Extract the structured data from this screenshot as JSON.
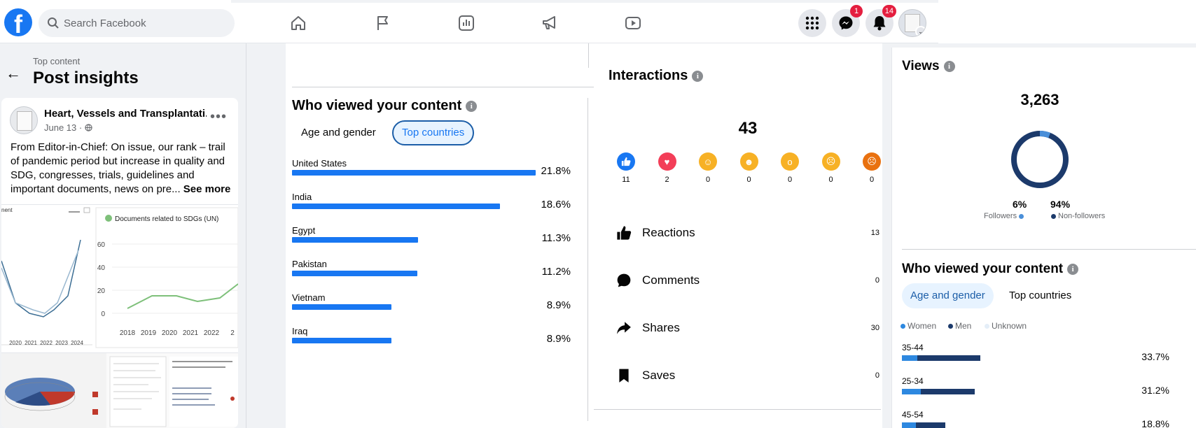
{
  "topbar": {
    "logo": "f",
    "search_placeholder": "Search Facebook",
    "nav_icons": [
      "home-icon",
      "flag-icon",
      "insights-icon",
      "megaphone-icon",
      "video-icon"
    ],
    "messenger_badge": "1",
    "notifications_badge": "14"
  },
  "left": {
    "breadcrumb": "Top content",
    "title": "Post insights",
    "post": {
      "author": "Heart, Vessels and Transplantati...",
      "date": "June 13 ·",
      "text": "From Editor-in-Chief: On issue, our rank – trail of pandemic period but increase in quality and SDG, congresses, trials, guidelines and important documents, news on pre...",
      "see_more": "See more",
      "image_legend": "Documents related to SDGs (UN)",
      "image_corner": "nent",
      "image_years": [
        "2018",
        "2019",
        "2020",
        "2021",
        "2022",
        "2"
      ],
      "image_y_ticks": [
        "60",
        "40",
        "20",
        "0"
      ],
      "image_left_years": [
        "2020",
        "2021",
        "2022",
        "2023",
        "2024"
      ]
    }
  },
  "who_viewed_countries": {
    "title": "Who viewed your content",
    "tabs": [
      "Age and gender",
      "Top countries"
    ],
    "active_tab": "Top countries",
    "countries": [
      {
        "name": "United States",
        "pct": "21.8%",
        "value": 21.8
      },
      {
        "name": "India",
        "pct": "18.6%",
        "value": 18.6
      },
      {
        "name": "Egypt",
        "pct": "11.3%",
        "value": 11.3
      },
      {
        "name": "Pakistan",
        "pct": "11.2%",
        "value": 11.2
      },
      {
        "name": "Vietnam",
        "pct": "8.9%",
        "value": 8.9
      },
      {
        "name": "Iraq",
        "pct": "8.9%",
        "value": 8.9
      }
    ]
  },
  "interactions": {
    "title": "Interactions",
    "total": "43",
    "reactions": [
      {
        "icon": "like-icon",
        "count": "11",
        "color": "#1877f2"
      },
      {
        "icon": "love-icon",
        "count": "2",
        "color": "#f33e58"
      },
      {
        "icon": "care-icon",
        "count": "0",
        "color": "#f7b125"
      },
      {
        "icon": "haha-icon",
        "count": "0",
        "color": "#f7b125"
      },
      {
        "icon": "wow-icon",
        "count": "0",
        "color": "#f7b125"
      },
      {
        "icon": "sad-icon",
        "count": "0",
        "color": "#f7b125"
      },
      {
        "icon": "angry-icon",
        "count": "0",
        "color": "#e9710f"
      }
    ],
    "metrics": [
      {
        "label": "Reactions",
        "value": "13",
        "icon": "thumbs-up-icon"
      },
      {
        "label": "Comments",
        "value": "0",
        "icon": "comment-icon"
      },
      {
        "label": "Shares",
        "value": "30",
        "icon": "share-icon"
      },
      {
        "label": "Saves",
        "value": "0",
        "icon": "bookmark-icon"
      }
    ]
  },
  "views": {
    "title": "Views",
    "total": "3,263",
    "followers_pct": "6%",
    "non_followers_pct": "94%",
    "followers_label": "Followers",
    "non_followers_label": "Non-followers",
    "followers_fraction": 0.06,
    "followers_color": "#4a8fd9",
    "non_followers_color": "#1c3a6b"
  },
  "who_viewed_age": {
    "title": "Who viewed your content",
    "tabs": [
      "Age and gender",
      "Top countries"
    ],
    "active_tab": "Age and gender",
    "legend": [
      "Women",
      "Men",
      "Unknown"
    ],
    "legend_colors": [
      "#2d88e0",
      "#1c3a6b",
      "#e4eef8"
    ],
    "rows": [
      {
        "age": "35-44",
        "pct": "33.7%",
        "women": 6.5,
        "men": 27.2
      },
      {
        "age": "25-34",
        "pct": "31.2%",
        "women": 8.0,
        "men": 23.2
      },
      {
        "age": "45-54",
        "pct": "18.8%",
        "women": 6.0,
        "men": 12.8
      }
    ]
  }
}
